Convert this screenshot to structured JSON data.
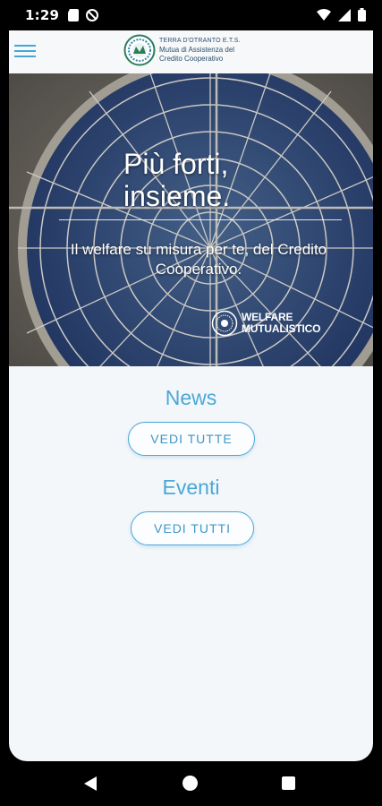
{
  "status_bar": {
    "time": "1:29",
    "left_icons": [
      "sd-card-icon",
      "no-disturb-icon"
    ],
    "right_icons": [
      "wifi-icon",
      "signal-icon",
      "battery-icon"
    ]
  },
  "app_bar": {
    "menu_icon": "hamburger-menu-icon",
    "logo": {
      "line1": "TERRA D'OTRANTO E.T.S.",
      "line2": "Mutua di Assistenza del",
      "line3": "Credito Cooperativo"
    }
  },
  "hero": {
    "title_line1": "Più forti,",
    "title_line2": "insieme.",
    "subtitle": "Il welfare su misura per te, del Credito Cooperativo.",
    "badge_line1": "WELFARE",
    "badge_line2": "MUTUALISTICO"
  },
  "sections": {
    "news": {
      "title": "News",
      "button_label": "VEDI TUTTE"
    },
    "events": {
      "title": "Eventi",
      "button_label": "VEDI TUTTI"
    }
  },
  "nav_bar": {
    "icons": [
      "back-icon",
      "home-icon",
      "recents-icon"
    ]
  },
  "colors": {
    "accent": "#4aa8d8",
    "background": "#f4f7fa",
    "logo_text": "#2c4f6e"
  }
}
